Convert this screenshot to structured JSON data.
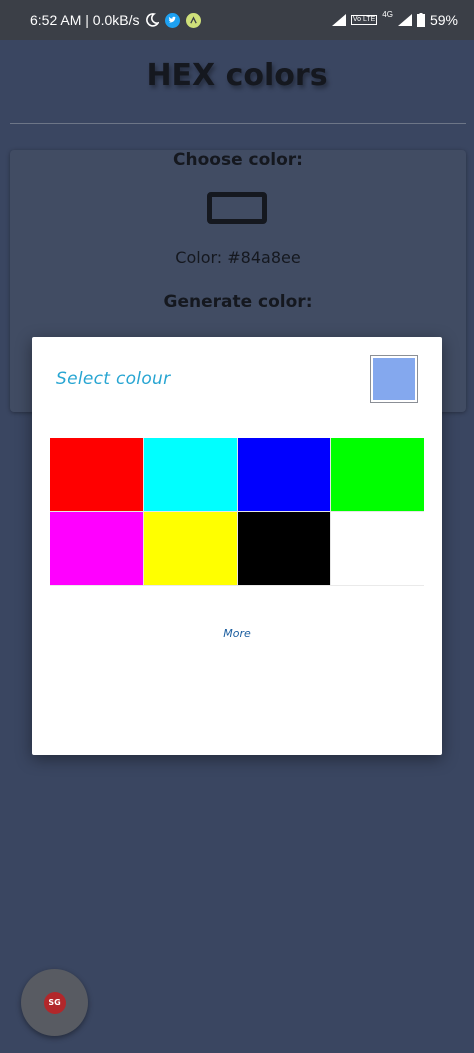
{
  "status_bar": {
    "time_speed": "6:52 AM | 0.0kB/s",
    "battery": "59%",
    "network_label": "4G",
    "volte_label": "Vo LTE",
    "icons": [
      "moon-icon",
      "twitter-icon",
      "app-notification-icon",
      "signal-icon",
      "battery-icon"
    ]
  },
  "app": {
    "title": "HEX colors",
    "choose_label": "Choose color:",
    "color_text": "Color: #84a8ee",
    "generate_label": "Generate color:",
    "current_color": "#84a8ee"
  },
  "dialog": {
    "title": "Select colour",
    "preview_color": "#84a8ee",
    "more_label": "More",
    "swatches": [
      "#ff0000",
      "#00ffff",
      "#0000ff",
      "#00ff00",
      "#ff00ff",
      "#ffff00",
      "#000000",
      "#ffffff"
    ]
  },
  "fab": {
    "logo_text": "SG"
  }
}
